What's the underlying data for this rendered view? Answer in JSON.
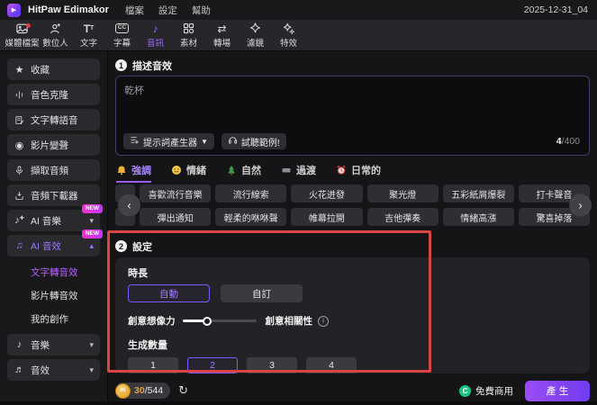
{
  "titlebar": {
    "app_title": "HitPaw Edimakor",
    "menus": [
      "檔案",
      "設定",
      "幫助"
    ],
    "date": "2025-12-31_04"
  },
  "toolbar": {
    "items": [
      {
        "icon": "media-files-icon",
        "label": "媒體檔案",
        "notification_dot": true
      },
      {
        "icon": "digital-human-icon",
        "label": "數位人"
      },
      {
        "icon": "text-icon",
        "label": "文字"
      },
      {
        "icon": "subtitle-icon",
        "label": "字幕"
      },
      {
        "icon": "audio-icon",
        "label": "音訊",
        "active": true
      },
      {
        "icon": "assets-icon",
        "label": "素材"
      },
      {
        "icon": "transition-icon",
        "label": "轉場"
      },
      {
        "icon": "filter-icon",
        "label": "濾鏡"
      },
      {
        "icon": "effects-icon",
        "label": "特效"
      }
    ]
  },
  "sidebar": {
    "items": [
      {
        "icon": "star-icon",
        "label": "收藏"
      },
      {
        "icon": "voice-clone-icon",
        "label": "音色克隆"
      },
      {
        "icon": "text-to-speech-icon",
        "label": "文字轉語音"
      },
      {
        "icon": "voice-changer-icon",
        "label": "影片變聲"
      },
      {
        "icon": "extract-audio-icon",
        "label": "擷取音頻"
      },
      {
        "icon": "audio-downloader-icon",
        "label": "音頻下載器"
      },
      {
        "icon": "ai-music-icon",
        "label": "AI 音樂",
        "badge": "NEW",
        "chevron": "▾"
      },
      {
        "icon": "ai-sfx-icon",
        "label": "AI 音效",
        "badge": "NEW",
        "chevron": "▴",
        "active": true
      }
    ],
    "sub_items": [
      {
        "label": "文字轉音效",
        "active": true
      },
      {
        "label": "影片轉音效"
      },
      {
        "label": "我的創作"
      }
    ],
    "bottom_items": [
      {
        "icon": "music-icon",
        "label": "音樂",
        "chevron": "▾"
      },
      {
        "icon": "sound-effect-icon",
        "label": "音效",
        "chevron": "▾"
      }
    ]
  },
  "describe": {
    "step": "1",
    "title": "描述音效",
    "input_value": "乾杯",
    "prompt_generator_label": "提示詞產生器",
    "sample_label": "試聽範例!",
    "char_count": "4",
    "char_limit": "/400"
  },
  "tabs": [
    {
      "icon": "bell-icon",
      "label": "強調",
      "active": true
    },
    {
      "icon": "smiley-icon",
      "label": "情緒"
    },
    {
      "icon": "tree-icon",
      "label": "自然"
    },
    {
      "icon": "clip-icon",
      "label": "過渡"
    },
    {
      "icon": "alarm-clock-icon",
      "label": "日常的"
    }
  ],
  "chips": {
    "row1": [
      "喜歡流行音樂",
      "流行線索",
      "火花迸發",
      "聚光燈",
      "五彩紙屑爆裂",
      "打卡聲音"
    ],
    "row2": [
      "彈出通知",
      "輕柔的咻咻聲",
      "帷幕拉開",
      "吉他彈奏",
      "情緒高漲",
      "驚喜掉落"
    ]
  },
  "settings": {
    "step": "2",
    "title": "設定",
    "duration_label": "時長",
    "duration_options": [
      {
        "label": "自動",
        "active": true
      },
      {
        "label": "自訂"
      }
    ],
    "creativity_left_label": "創意想像力",
    "creativity_right_label": "創意相關性",
    "slider_value_pct": 34,
    "count_label": "生成數量",
    "count_options": [
      {
        "label": "1"
      },
      {
        "label": "2",
        "active": true
      },
      {
        "label": "3"
      },
      {
        "label": "4"
      }
    ]
  },
  "footer": {
    "coin_text": "AI",
    "credits_used": "30",
    "credits_total": "/544",
    "commercial_label": "免費商用",
    "generate_label": "產生"
  },
  "colors": {
    "accent_purple": "#9b6bff",
    "selected_purple_border": "#7e57ff",
    "sidebar_active_purple": "#b560ff",
    "new_badge_magenta": "#e23cdc",
    "highlight_red": "#d94545",
    "commercial_green": "#18c686",
    "coin_gold": "#e8a23c",
    "generate_gradient": "#9a4df7"
  }
}
